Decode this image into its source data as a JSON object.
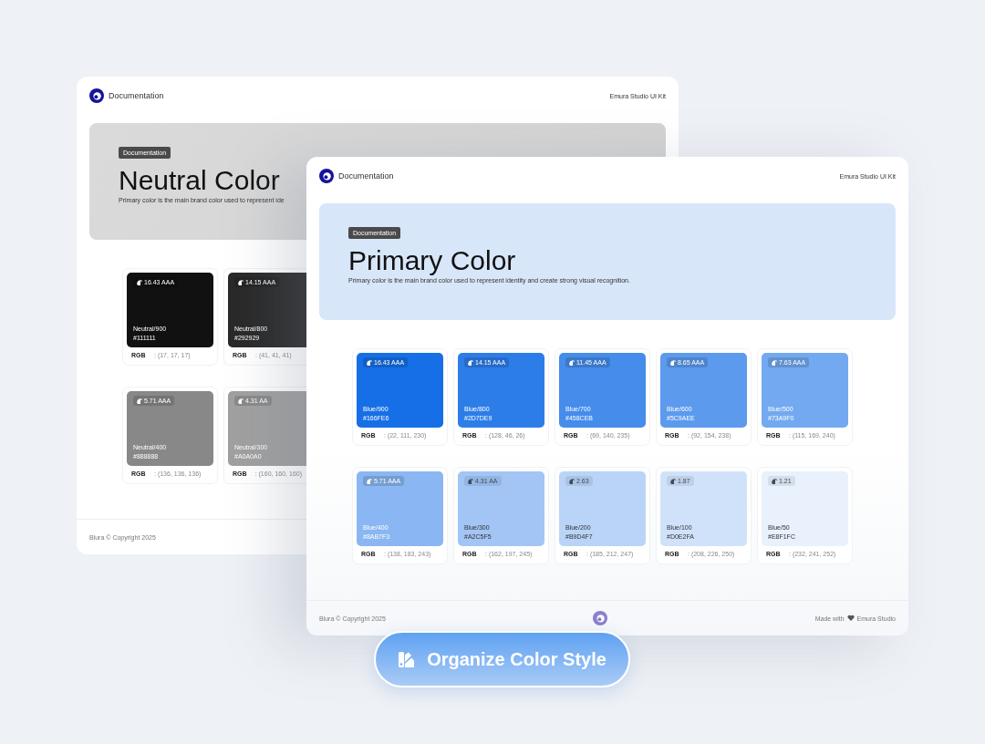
{
  "back_page": {
    "header": {
      "brand": "Documentation",
      "kit": "Emura Studio UI Kit"
    },
    "hero": {
      "badge": "Documentation",
      "title": "Neutral Color",
      "description": "Primary color is the main brand color used to represent ide",
      "kind": "neutral"
    },
    "rows": [
      [
        {
          "contrast": "16.43 AAA",
          "name": "Neutral/900",
          "hex": "#111111",
          "color": "#111111",
          "dark_text": false,
          "rgb_label": "RGB",
          "rgb": ": (17, 17, 17)"
        },
        {
          "contrast": "14.15 AAA",
          "name": "Neutral/800",
          "hex": "#292929",
          "color": "#292929",
          "dark_text": false,
          "rgb_label": "RGB",
          "rgb": ": (41, 41, 41)"
        }
      ],
      [
        {
          "contrast": "5.71 AAA",
          "name": "Neutral/400",
          "hex": "#888888",
          "color": "#888888",
          "dark_text": false,
          "rgb_label": "RGB",
          "rgb": ": (136, 136, 136)"
        },
        {
          "contrast": "4.31 AA",
          "name": "Neutral/300",
          "hex": "#A0A0A0",
          "color": "#a0a0a0",
          "dark_text": false,
          "rgb_label": "RGB",
          "rgb": ": (160, 160, 160)"
        }
      ]
    ],
    "footer": {
      "copyright": "Blura © Copyright 2025"
    }
  },
  "front_page": {
    "header": {
      "brand": "Documentation",
      "kit": "Emura Studio UI Kit"
    },
    "hero": {
      "badge": "Documentation",
      "title": "Primary Color",
      "description": "Primary color is the main brand color used to represent identity and create strong visual recognition.",
      "kind": "blue"
    },
    "rows": [
      [
        {
          "contrast": "16.43 AAA",
          "name": "Blue/900",
          "hex": "#166FE6",
          "color": "#166fe6",
          "dark_text": false,
          "rgb_label": "RGB",
          "rgb": ": (22, 111, 230)"
        },
        {
          "contrast": "14.15 AAA",
          "name": "Blue/800",
          "hex": "#2D7DE9",
          "color": "#2d7de9",
          "dark_text": false,
          "rgb_label": "RGB",
          "rgb": ": (128, 46, 26)"
        },
        {
          "contrast": "11.45 AAA",
          "name": "Blue/700",
          "hex": "#458CEB",
          "color": "#458ceb",
          "dark_text": false,
          "rgb_label": "RGB",
          "rgb": ": (69, 140, 235)"
        },
        {
          "contrast": "8.65 AAA",
          "name": "Blue/600",
          "hex": "#5C9AEE",
          "color": "#5c9aee",
          "dark_text": false,
          "rgb_label": "RGB",
          "rgb": ": (92, 154, 238)"
        },
        {
          "contrast": "7.63 AAA",
          "name": "Blue/500",
          "hex": "#73A9F0",
          "color": "#73a9f0",
          "dark_text": false,
          "rgb_label": "RGB",
          "rgb": ": (115, 169, 240)"
        }
      ],
      [
        {
          "contrast": "5.71 AAA",
          "name": "Blue/400",
          "hex": "#8AB7F3",
          "color": "#8ab7f3",
          "dark_text": false,
          "rgb_label": "RGB",
          "rgb": ": (138, 183, 243)"
        },
        {
          "contrast": "4.31 AA",
          "name": "Blue/300",
          "hex": "#A2C5F5",
          "color": "#a2c5f5",
          "dark_text": true,
          "rgb_label": "RGB",
          "rgb": ": (162, 197, 245)"
        },
        {
          "contrast": "2.63",
          "name": "Blue/200",
          "hex": "#B9D4F7",
          "color": "#b9d4f7",
          "dark_text": true,
          "rgb_label": "RGB",
          "rgb": ": (185, 212, 247)"
        },
        {
          "contrast": "1.87",
          "name": "Blue/100",
          "hex": "#D0E2FA",
          "color": "#d0e2fa",
          "dark_text": true,
          "rgb_label": "RGB",
          "rgb": ": (208, 226, 250)"
        },
        {
          "contrast": "1.21",
          "name": "Blue/50",
          "hex": "#E8F1FC",
          "color": "#e8f1fc",
          "dark_text": true,
          "rgb_label": "RGB",
          "rgb": ": (232, 241, 252)"
        }
      ]
    ],
    "footer": {
      "copyright": "Blura © Copyright 2025",
      "made_with": "Made with",
      "author": "Emura Studio"
    }
  },
  "cta_button": {
    "label": "Organize Color Style"
  }
}
